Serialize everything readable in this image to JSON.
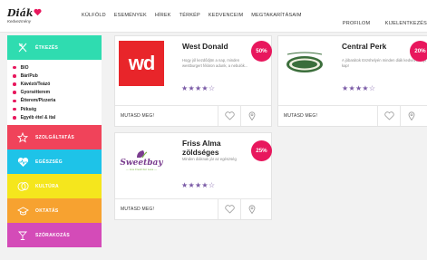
{
  "logo": {
    "name": "Diák",
    "tagline": "Kedvezmény"
  },
  "nav": {
    "items": [
      "KÜLFÖLD",
      "ESEMÉNYEK",
      "HÍREK",
      "TÉRKÉP",
      "KEDVENCEIM",
      "MEGTAKARÍTÁSAIM"
    ],
    "right": [
      "PROFILOM",
      "KIJELENTKEZÉS"
    ]
  },
  "sidebar": {
    "categories": [
      {
        "label": "ÉTKEZÉS",
        "color": "#2fdcb0",
        "icon": "utensils-icon"
      },
      {
        "label": "SZOLGÁLTATÁS",
        "color": "#f0435a",
        "icon": "star-icon"
      },
      {
        "label": "EGÉSZSÉG",
        "color": "#1ec3e8",
        "icon": "heartbeat-icon"
      },
      {
        "label": "KULTÚRA",
        "color": "#f5e61d",
        "icon": "masks-icon"
      },
      {
        "label": "OKTATÁS",
        "color": "#f7a230",
        "icon": "graduation-cap-icon"
      },
      {
        "label": "SZÓRAKOZÁS",
        "color": "#d44bb8",
        "icon": "cocktail-icon"
      }
    ],
    "subitems": [
      "BIO",
      "Bár/Pub",
      "Kávézó/Teázó",
      "Gyorsétterem",
      "Étterem/Pizzeria",
      "Pékség",
      "Egyéb étel & ital"
    ]
  },
  "cards": [
    {
      "title": "West Donald",
      "desc": "Hogy jól kezdődjön a nap, minden westburgert féláron adunk, a nebulók...",
      "badge": "50%",
      "logo_text": "wd",
      "stars": "★★★★☆",
      "more": "MUTASD MEG!"
    },
    {
      "title": "Central Perk",
      "desc": "A jóbarátok törzshelyén minden diák kedvezményt kap!",
      "badge": "20%",
      "logo_text": "CENTRAL PERK",
      "stars": "★★★★☆",
      "more": "MUTASD MEG!"
    },
    {
      "title": "Friss Alma zöldséges",
      "desc": "Minden diáknak jár az egészség",
      "badge": "25%",
      "logo_text": "Sweetbay",
      "logo_sub": "— Live Fresh For Less —",
      "stars": "★★★★☆",
      "more": "MUTASD MEG!"
    }
  ],
  "colors": {
    "accent": "#e8175d",
    "star": "#7a5aa6"
  }
}
